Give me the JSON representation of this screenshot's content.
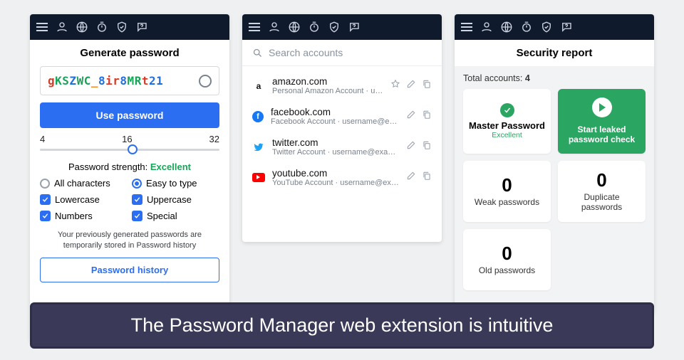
{
  "panel1": {
    "title": "Generate password",
    "password_chars": [
      {
        "c": "g",
        "cls": "r"
      },
      {
        "c": "K",
        "cls": "g"
      },
      {
        "c": "S",
        "cls": "g"
      },
      {
        "c": "Z",
        "cls": "b"
      },
      {
        "c": "W",
        "cls": "g"
      },
      {
        "c": "C",
        "cls": "g"
      },
      {
        "c": "_",
        "cls": "o"
      },
      {
        "c": "8",
        "cls": "b"
      },
      {
        "c": "i",
        "cls": "r"
      },
      {
        "c": "r",
        "cls": "r"
      },
      {
        "c": "8",
        "cls": "b"
      },
      {
        "c": "M",
        "cls": "g"
      },
      {
        "c": "R",
        "cls": "g"
      },
      {
        "c": "t",
        "cls": "r"
      },
      {
        "c": "2",
        "cls": "b"
      },
      {
        "c": "1",
        "cls": "b"
      }
    ],
    "use_label": "Use password",
    "scale": {
      "min": "4",
      "mid": "16",
      "max": "32"
    },
    "strength_label": "Password strength: ",
    "strength_value": "Excellent",
    "opts": {
      "all_chars": "All characters",
      "easy_type": "Easy to type",
      "lower": "Lowercase",
      "upper": "Uppercase",
      "numbers": "Numbers",
      "special": "Special"
    },
    "hint": "Your previously generated passwords are temporarily stored in Password history",
    "history_label": "Password history"
  },
  "panel2": {
    "search_placeholder": "Search accounts",
    "accounts": [
      {
        "site": "amazon.com",
        "sub": "Personal Amazon Account · us…",
        "favorite": true
      },
      {
        "site": "facebook.com",
        "sub": "Facebook Account · username@exa…",
        "favorite": false
      },
      {
        "site": "twitter.com",
        "sub": "Twitter Account · username@exampl…",
        "favorite": false
      },
      {
        "site": "youtube.com",
        "sub": "YouTube Account · username@exam…",
        "favorite": false
      }
    ]
  },
  "panel3": {
    "title": "Security report",
    "total_label": "Total accounts: ",
    "total_value": "4",
    "master": {
      "name": "Master Password",
      "status": "Excellent"
    },
    "leak_label": "Start leaked password check",
    "weak": {
      "count": "0",
      "label": "Weak passwords"
    },
    "dup": {
      "count": "0",
      "label": "Duplicate passwords"
    },
    "old": {
      "count": "0",
      "label": "Old passwords"
    }
  },
  "caption": "The Password Manager web extension is intuitive"
}
